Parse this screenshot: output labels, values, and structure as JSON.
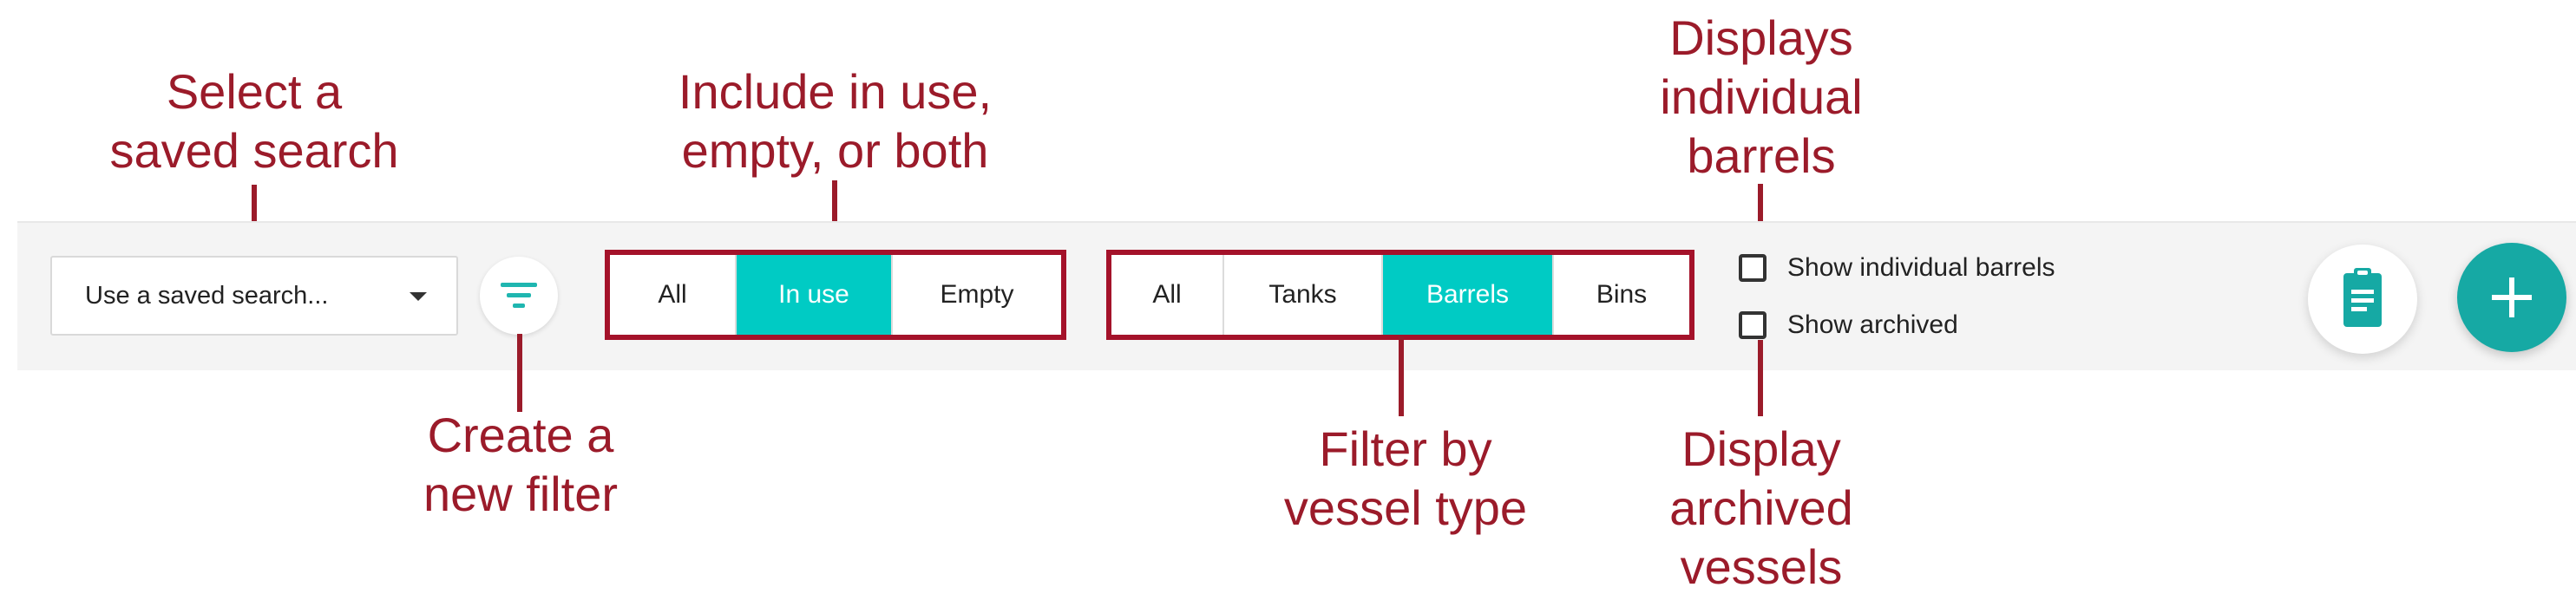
{
  "toolbar": {
    "saved_search": {
      "placeholder": "Use a saved search..."
    },
    "filter_button_icon": "filter-list-icon",
    "status_group": {
      "options": [
        "All",
        "In use",
        "Empty"
      ],
      "selected": "In use"
    },
    "vessel_group": {
      "options": [
        "All",
        "Tanks",
        "Barrels",
        "Bins"
      ],
      "selected": "Barrels"
    },
    "checkboxes": {
      "show_individual_barrels": {
        "label": "Show individual barrels",
        "checked": false
      },
      "show_archived": {
        "label": "Show archived",
        "checked": false
      }
    },
    "clipboard_icon": "clipboard-icon",
    "add_icon": "plus-icon"
  },
  "annotations": {
    "saved_search": [
      "Select a",
      "saved search"
    ],
    "new_filter": [
      "Create a",
      "new filter"
    ],
    "status": [
      "Include in use,",
      "empty, or both"
    ],
    "vessel_type": [
      "Filter by",
      "vessel type"
    ],
    "individual_barrels": [
      "Displays",
      "individual",
      "barrels"
    ],
    "archived": [
      "Display",
      "archived",
      "vessels"
    ]
  },
  "colors": {
    "accent": "#00cbc4",
    "accent_dark": "#16a9a4",
    "annotation": "#9b1b2a",
    "highlight_border": "#a4122a"
  }
}
